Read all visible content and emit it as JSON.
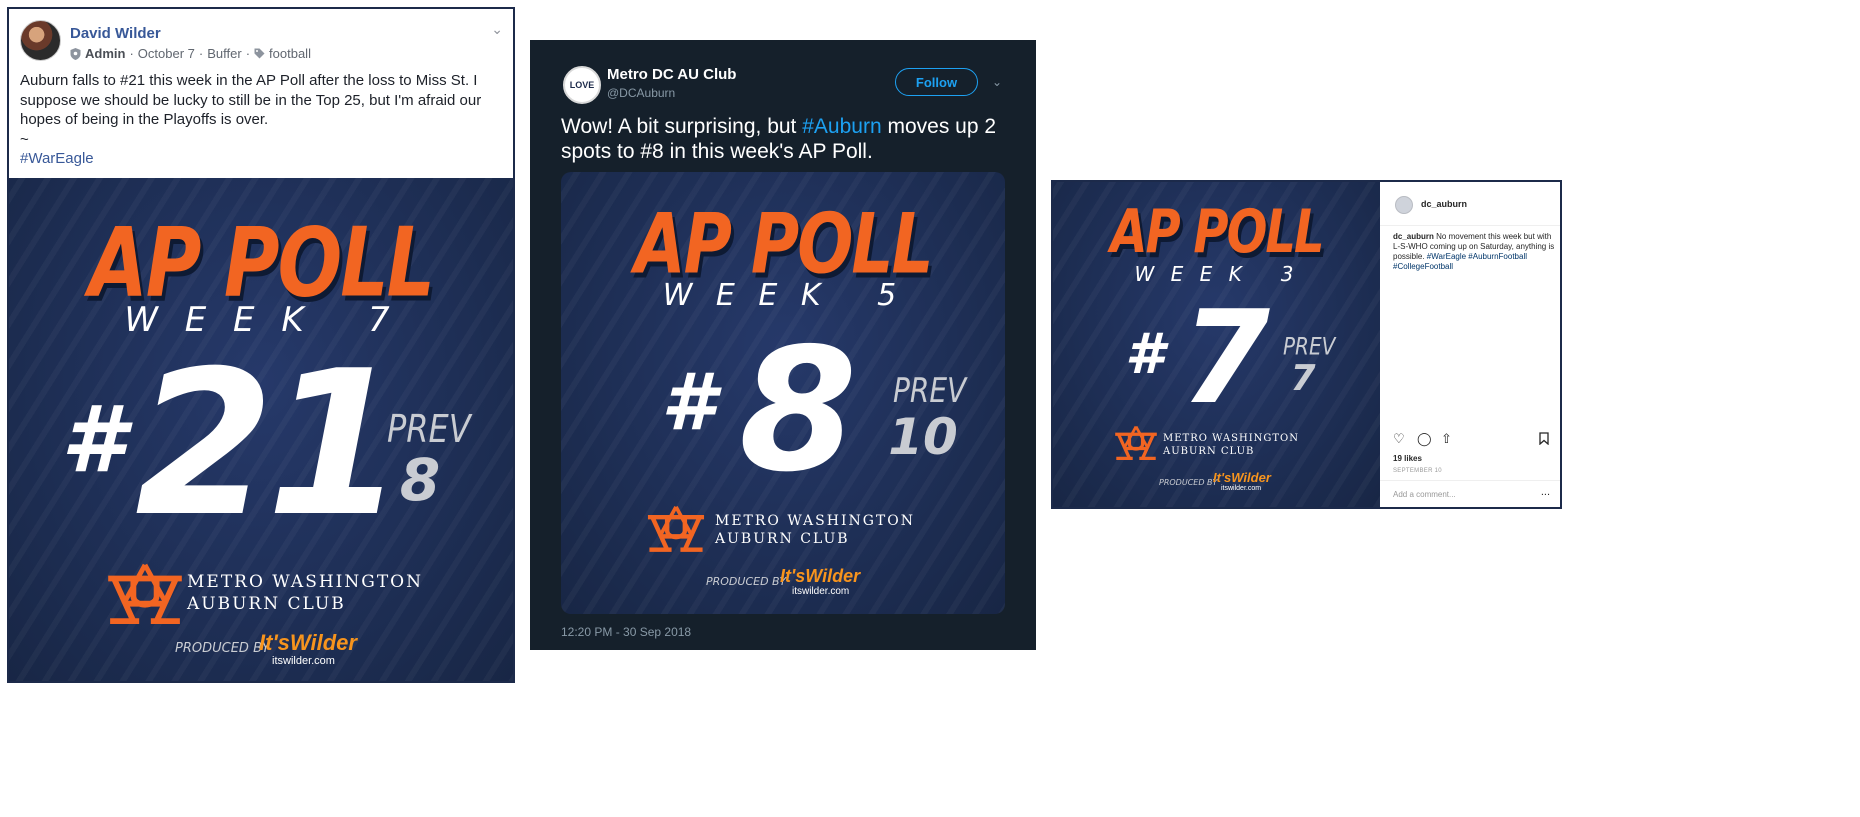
{
  "facebook": {
    "author": "David Wilder",
    "role": "Admin",
    "date": "October 7",
    "via": "Buffer",
    "tag": "football",
    "text": "Auburn falls to #21 this week in the AP Poll after the loss to Miss St. I suppose we should be lucky to still be in the Top 25, but I'm afraid our hopes of being in the Playoffs is over.",
    "tilde": "~",
    "hashtag": "#WarEagle",
    "poster": {
      "title": "AP POLL",
      "week": "W E E K   7",
      "hash": "#",
      "rank": "21",
      "prev_label": "PREV",
      "prev": "8",
      "club_line1": "METRO WASHINGTON",
      "club_line2": "AUBURN CLUB",
      "produced_by": "PRODUCED BY",
      "sponsor": "It'sWilder",
      "sponsor_url": "itswilder.com"
    }
  },
  "twitter": {
    "name": "Metro DC AU Club",
    "handle": "@DCAuburn",
    "avatar_text": "LOVE",
    "follow_label": "Follow",
    "text_before": "Wow! A bit surprising, but ",
    "hashtag": "#Auburn",
    "text_after": " moves up 2 spots to #8 in this week's AP Poll.",
    "timestamp": "12:20 PM - 30 Sep 2018",
    "poster": {
      "title": "AP POLL",
      "week": "W E E K   5",
      "hash": "#",
      "rank": "8",
      "prev_label": "PREV",
      "prev": "10",
      "club_line1": "METRO WASHINGTON",
      "club_line2": "AUBURN CLUB",
      "produced_by": "PRODUCED BY",
      "sponsor": "It'sWilder",
      "sponsor_url": "itswilder.com"
    }
  },
  "instagram": {
    "username": "dc_auburn",
    "caption_user": "dc_auburn",
    "caption_text": " No movement this week but with L-S-WHO coming up on Saturday, anything is possible. ",
    "caption_tags": "#WarEagle #AuburnFootball #CollegeFootball",
    "likes": "19 likes",
    "date": "SEPTEMBER 10",
    "comment_placeholder": "Add a comment...",
    "more": "...",
    "poster": {
      "title": "AP POLL",
      "week": "W E E K   3",
      "hash": "#",
      "rank": "7",
      "prev_label": "PREV",
      "prev": "7",
      "club_line1": "METRO WASHINGTON",
      "club_line2": "AUBURN CLUB",
      "produced_by": "PRODUCED BY",
      "sponsor": "It'sWilder",
      "sponsor_url": "itswilder.com"
    }
  },
  "colors": {
    "auburn_orange": "#f26522",
    "auburn_navy": "#1f3157",
    "facebook_link": "#385898",
    "twitter_blue": "#1da1f2",
    "twitter_bg": "#15202b"
  }
}
